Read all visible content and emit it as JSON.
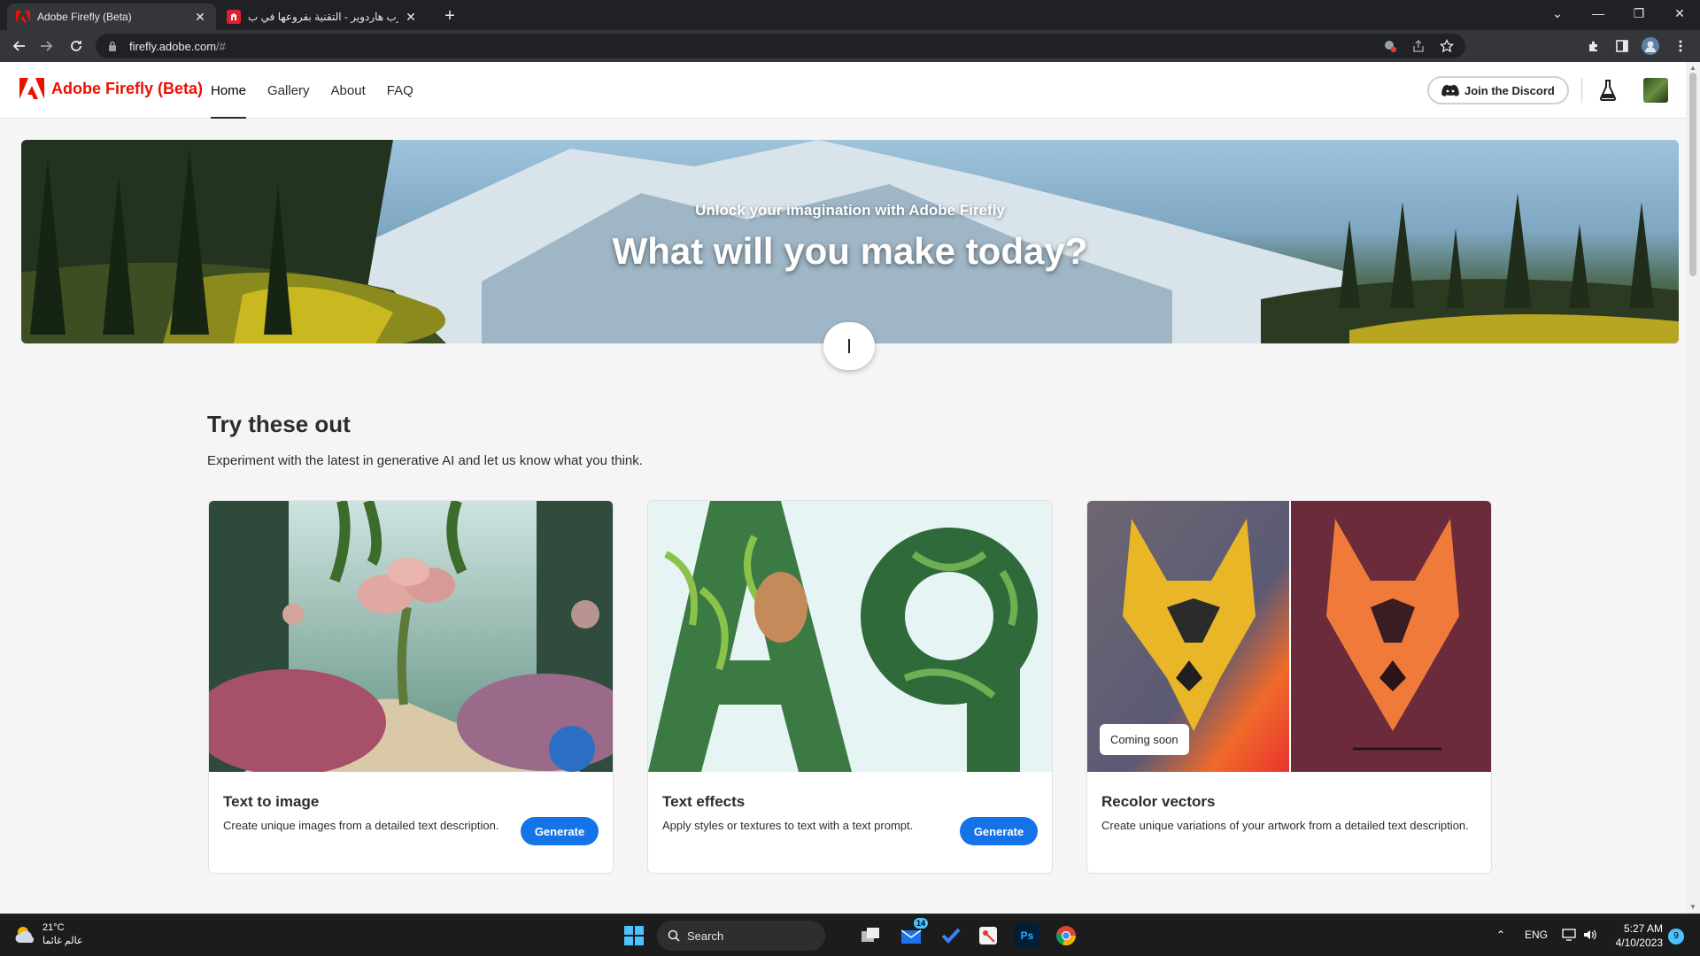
{
  "browser": {
    "tabs": [
      {
        "title": "Adobe Firefly (Beta)",
        "active": true
      },
      {
        "title": "عرب هاردوير - التقنية بفروعها في ب",
        "active": false
      }
    ],
    "new_tab": "+",
    "url_host": "firefly.adobe.com",
    "url_path": "/#",
    "window_controls": {
      "minimize": "—",
      "restore": "❐",
      "close": "✕",
      "dropdown": "⌄"
    }
  },
  "site": {
    "brand": "Adobe Firefly (Beta)",
    "nav": [
      {
        "label": "Home",
        "active": true
      },
      {
        "label": "Gallery",
        "active": false
      },
      {
        "label": "About",
        "active": false
      },
      {
        "label": "FAQ",
        "active": false
      }
    ],
    "discord_label": "Join the Discord",
    "accent": "#eb1000",
    "button_color": "#1473e6"
  },
  "hero": {
    "subtitle": "Unlock your imagination with Adobe Firefly",
    "headline": "What will you make today?"
  },
  "section": {
    "title": "Try these out",
    "subtitle": "Experiment with the latest in generative AI and let us know what you think."
  },
  "cards": [
    {
      "title": "Text to image",
      "description": "Create unique images from a detailed text description.",
      "button": "Generate"
    },
    {
      "title": "Text effects",
      "description": "Apply styles or textures to text with a text prompt.",
      "button": "Generate"
    },
    {
      "title": "Recolor vectors",
      "description": "Create unique variations of your artwork from a detailed text description.",
      "badge": "Coming soon"
    }
  ],
  "taskbar": {
    "weather_temp": "21°C",
    "weather_text": "عالم غائما",
    "search_label": "Search",
    "mail_badge": "14",
    "ps_label": "Ps",
    "language": "ENG",
    "time": "5:27 AM",
    "date": "4/10/2023",
    "notifications": "9"
  }
}
